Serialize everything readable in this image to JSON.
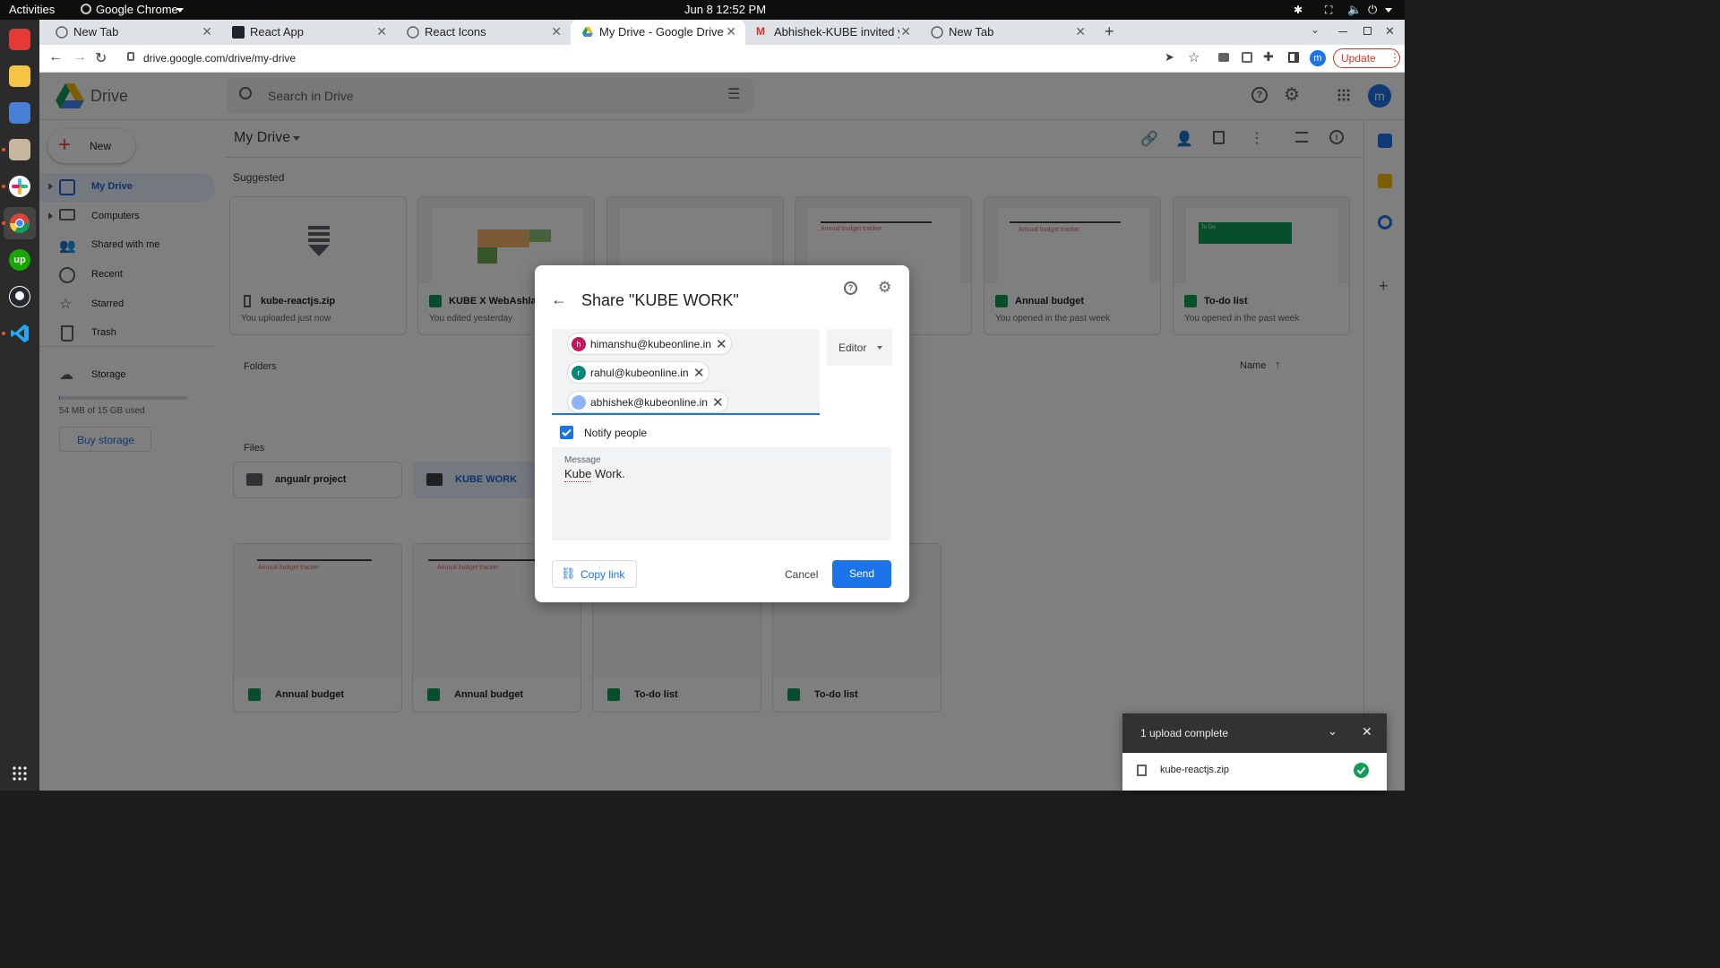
{
  "topbar": {
    "activities": "Activities",
    "app_name": "Google Chrome",
    "datetime": "Jun 8  12:52 PM"
  },
  "tabs": [
    {
      "label": "New Tab"
    },
    {
      "label": "React App"
    },
    {
      "label": "React Icons"
    },
    {
      "label": "My Drive - Google Drive"
    },
    {
      "label": "Abhishek-KUBE invited yo"
    },
    {
      "label": "New Tab"
    }
  ],
  "omnibox": {
    "url": "drive.google.com/drive/my-drive",
    "update_label": "Update",
    "profile_initial": "m"
  },
  "drive": {
    "app_title": "Drive",
    "search_placeholder": "Search in Drive",
    "user_initial": "m",
    "new_label": "New",
    "breadcrumb": "My Drive",
    "nav": [
      {
        "label": "My Drive"
      },
      {
        "label": "Computers"
      },
      {
        "label": "Shared with me"
      },
      {
        "label": "Recent"
      },
      {
        "label": "Starred"
      },
      {
        "label": "Trash"
      },
      {
        "label": "Storage"
      }
    ],
    "storage_used": "54 MB of 15 GB used",
    "storage_fraction": 0.0036,
    "buy_storage": "Buy storage",
    "suggested_heading": "Suggested",
    "suggested": [
      {
        "title": "kube-reactjs.zip",
        "subtitle": "You uploaded just now"
      },
      {
        "title": "KUBE X WebAshlar",
        "subtitle": "You edited yesterday"
      },
      {
        "title": "",
        "subtitle": ""
      },
      {
        "title": "",
        "subtitle": ""
      },
      {
        "title": "Annual budget",
        "subtitle": "You opened in the past week"
      },
      {
        "title": "To-do list",
        "subtitle": "You opened in the past week"
      }
    ],
    "folders_heading": "Folders",
    "sort_label": "Name",
    "folders": [
      {
        "name": "angualr project"
      },
      {
        "name": "KUBE WORK"
      }
    ],
    "files_heading": "Files",
    "files": [
      {
        "name": "Annual budget"
      },
      {
        "name": "Annual budget"
      },
      {
        "name": "To-do list"
      },
      {
        "name": "To-do list"
      }
    ],
    "thumb_text": {
      "budget_title": "Annual budget tracker",
      "todo_title": "To Do"
    }
  },
  "dialog": {
    "title": "Share \"KUBE WORK\"",
    "recipients": [
      {
        "email": "himanshu@kubeonline.in",
        "initial": "h",
        "color": "#c2185b"
      },
      {
        "email": "rahul@kubeonline.in",
        "initial": "r",
        "color": "#00897b"
      },
      {
        "email": "abhishek@kubeonline.in",
        "initial": "",
        "color": "#8ab4f8"
      }
    ],
    "role": "Editor",
    "notify_label": "Notify people",
    "notify_checked": true,
    "message_label": "Message",
    "message_value": "Kube Work.",
    "copy_link": "Copy link",
    "cancel": "Cancel",
    "send": "Send",
    "accent": "#1a73e8"
  },
  "toast": {
    "title": "1 upload complete",
    "file": "kube-reactjs.zip"
  }
}
